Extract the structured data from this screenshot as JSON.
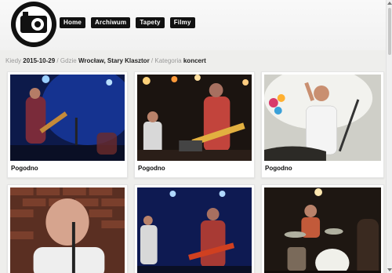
{
  "nav": {
    "items": [
      "Home",
      "Archiwum",
      "Tapety",
      "Filmy"
    ]
  },
  "breadcrumb": {
    "when_label": "Kiedy",
    "date": "2015-10-29",
    "where_label": "/ Gdzie",
    "place": "Wrocław, Stary Klasztor",
    "category_label": "/ Kategoria",
    "category": "koncert"
  },
  "photos": [
    {
      "caption": "Pogodno"
    },
    {
      "caption": "Pogodno"
    },
    {
      "caption": "Pogodno"
    },
    {
      "caption": ""
    },
    {
      "caption": ""
    },
    {
      "caption": ""
    }
  ],
  "colors": {
    "nav_bg": "#111111",
    "page_bg": "#eeeeec"
  }
}
